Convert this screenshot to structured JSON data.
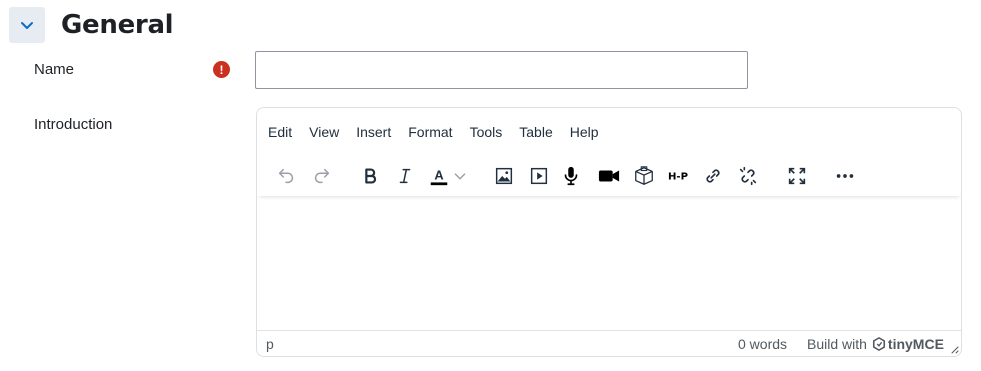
{
  "section": {
    "title": "General",
    "collapse_icon": "chevron-down-icon"
  },
  "fields": {
    "name": {
      "label": "Name",
      "value": "",
      "placeholder": "",
      "required_icon": "!"
    },
    "introduction": {
      "label": "Introduction"
    }
  },
  "editor": {
    "menus": [
      "Edit",
      "View",
      "Insert",
      "Format",
      "Tools",
      "Table",
      "Help"
    ],
    "toolbar_icons": [
      "undo-icon",
      "redo-icon",
      "bold-icon",
      "italic-icon",
      "text-color-icon",
      "chevron-down-icon",
      "image-icon",
      "media-icon",
      "microphone-icon",
      "video-camera-icon",
      "h5p-content-icon",
      "h5p-icon",
      "link-icon",
      "unlink-icon",
      "fullscreen-icon",
      "more-icon"
    ],
    "text_color_letter": "A",
    "h5p_label": "H-P",
    "statusbar": {
      "path": "p",
      "word_count": "0 words",
      "brand_prefix": "Build with",
      "brand_name": "tinyMCE"
    }
  },
  "colors": {
    "required": "#ca3120",
    "toolbar_icon": "#222f3e",
    "section_toggle_bg": "#e6ecf2"
  }
}
